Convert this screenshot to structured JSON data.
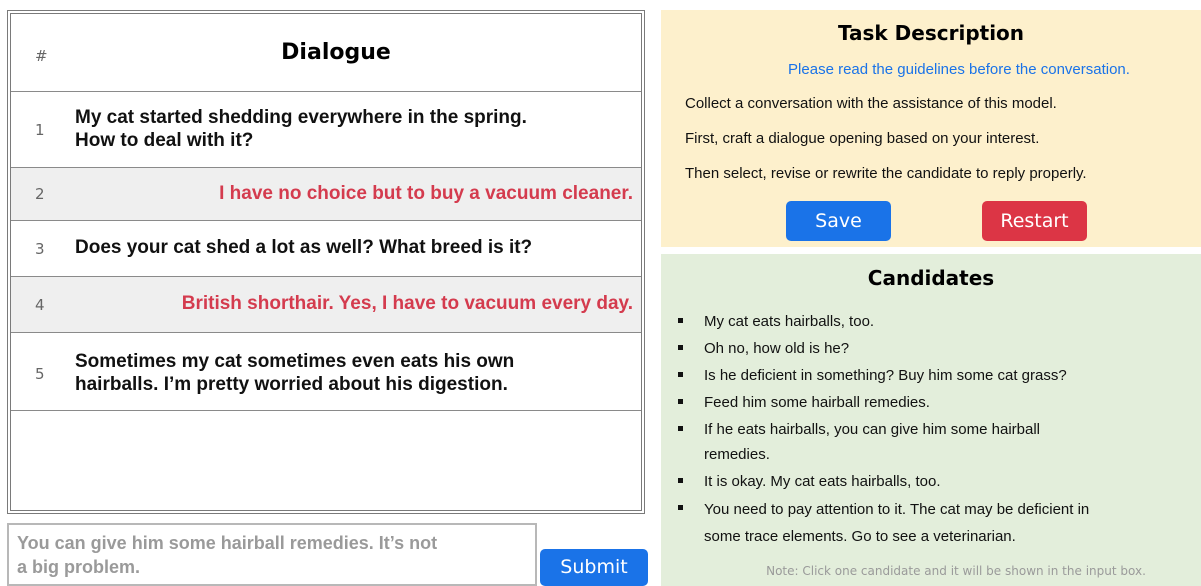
{
  "dialogue": {
    "hash_label": "#",
    "title": "Dialogue",
    "turns": [
      {
        "num": "1",
        "role": "user",
        "lines": [
          "My cat started shedding everywhere in the spring.",
          "How to deal with it?"
        ]
      },
      {
        "num": "2",
        "role": "ai",
        "lines": [
          "I have no choice but to buy a vacuum cleaner."
        ]
      },
      {
        "num": "3",
        "role": "user",
        "lines": [
          "Does your cat shed a lot as well? What breed is it?"
        ]
      },
      {
        "num": "4",
        "role": "ai",
        "lines": [
          "British shorthair. Yes, I have to vacuum every day."
        ]
      },
      {
        "num": "5",
        "role": "user",
        "lines": [
          "Sometimes my cat sometimes even eats his own",
          "hairballs. I’m pretty worried about his digestion."
        ]
      }
    ]
  },
  "input": {
    "value_lines": [
      "You can give him some hairball remedies. It’s not",
      "a big problem."
    ],
    "submit_label": "Submit"
  },
  "task": {
    "title": "Task Description",
    "guideline_link": "Please read the guidelines before the conversation.",
    "lines": [
      "Collect a conversation with the assistance of this model.",
      "First, craft a dialogue opening based on your interest.",
      "Then select, revise or rewrite the candidate to reply properly."
    ],
    "save_label": "Save",
    "restart_label": "Restart"
  },
  "candidates": {
    "title": "Candidates",
    "items": [
      [
        "My cat eats hairballs, too."
      ],
      [
        "Oh no, how old is he?"
      ],
      [
        "Is he deficient in something? Buy him some cat grass?"
      ],
      [
        "Feed him some hairball remedies."
      ],
      [
        "If he eats hairballs, you can give him some hairball",
        "remedies."
      ],
      [
        "It is okay. My cat eats hairballs, too."
      ],
      [
        "You need to pay attention to it. The cat may be deficient in",
        "some trace elements. Go to see a veterinarian."
      ]
    ],
    "note": "Note: Click one candidate and it will be shown in the input box."
  },
  "colors": {
    "user_text": "#111111",
    "ai_text": "#d43b4e",
    "primary": "#1a73e8",
    "danger": "#dc3545",
    "task_bg": "#fdf0cc",
    "candidates_bg": "#e3eedb"
  }
}
